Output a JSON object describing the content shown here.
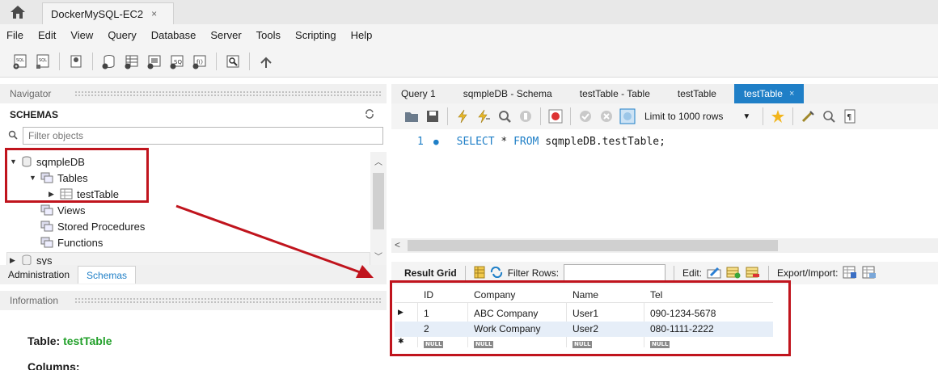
{
  "titlebar": {
    "connection_tab": "DockerMySQL-EC2",
    "close_glyph": "×"
  },
  "menu": [
    "File",
    "Edit",
    "View",
    "Query",
    "Database",
    "Server",
    "Tools",
    "Scripting",
    "Help"
  ],
  "navigator": {
    "header": "Navigator",
    "schemas_label": "SCHEMAS",
    "filter_placeholder": "Filter objects",
    "tree": {
      "schema1": "sqmpleDB",
      "tables": "Tables",
      "table1": "testTable",
      "views": "Views",
      "procs": "Stored Procedures",
      "functions": "Functions",
      "schema2": "sys"
    },
    "tabs": [
      "Administration",
      "Schemas"
    ]
  },
  "info": {
    "header": "Information",
    "table_prefix": "Table: ",
    "table_name": "testTable",
    "columns_label": "Columns:"
  },
  "editor": {
    "tabs": [
      "Query 1",
      "sqmpleDB - Schema",
      "testTable - Table",
      "testTable",
      "testTable"
    ],
    "limit": "Limit to 1000 rows",
    "line_number": "1",
    "sql": {
      "k1": "SELECT",
      "star": " * ",
      "k2": "FROM",
      "rest": " sqmpleDB.testTable;"
    }
  },
  "result": {
    "label": "Result Grid",
    "filter_label": "Filter Rows:",
    "edit_label": "Edit:",
    "export_label": "Export/Import:",
    "columns": [
      "ID",
      "Company",
      "Name",
      "Tel"
    ],
    "rows": [
      [
        "1",
        "ABC Company",
        "User1",
        "090-1234-5678"
      ],
      [
        "2",
        "Work Company",
        "User2",
        "080-1111-2222"
      ]
    ],
    "null_text": "NULL"
  },
  "colors": {
    "accent": "#1f7fc7",
    "annotation": "#c0141d",
    "table_name": "#22a02a"
  }
}
